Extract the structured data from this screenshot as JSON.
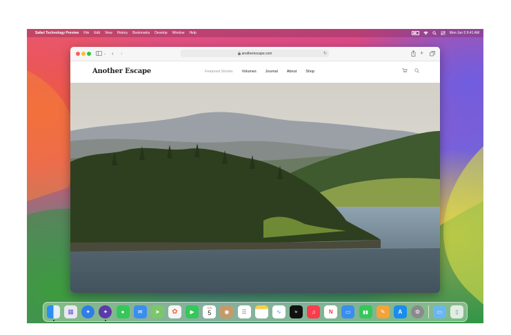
{
  "menubar": {
    "app_name": "Safari Technology Preview",
    "menus": [
      "File",
      "Edit",
      "View",
      "History",
      "Bookmarks",
      "Develop",
      "Window",
      "Help"
    ],
    "clock": "Mon Jun 5  9:41 AM"
  },
  "browser": {
    "url": "anotherescape.com"
  },
  "site": {
    "brand": "Another Escape",
    "nav": [
      {
        "label": "Featured Stories",
        "active": true
      },
      {
        "label": "Volumes",
        "active": false
      },
      {
        "label": "Journal",
        "active": false
      },
      {
        "label": "About",
        "active": false
      },
      {
        "label": "Shop",
        "active": false
      }
    ]
  },
  "dock": {
    "calendar_month": "JUN",
    "calendar_day": "5",
    "apps": [
      "Finder",
      "Launchpad",
      "Safari",
      "Safari Technology Preview",
      "Messages",
      "Mail",
      "Maps",
      "Photos",
      "FaceTime",
      "Calendar",
      "Contacts",
      "Reminders",
      "Notes",
      "Freeform",
      "TV",
      "Music",
      "News",
      "Keynote",
      "Numbers",
      "Pages",
      "App Store",
      "System Settings",
      "Downloads",
      "Trash"
    ]
  },
  "colors": {
    "desktop_pink": "#e8567a",
    "desktop_green": "#3aa04d",
    "close": "#ff5f57",
    "minimize": "#febc2e",
    "zoom": "#28c840"
  }
}
